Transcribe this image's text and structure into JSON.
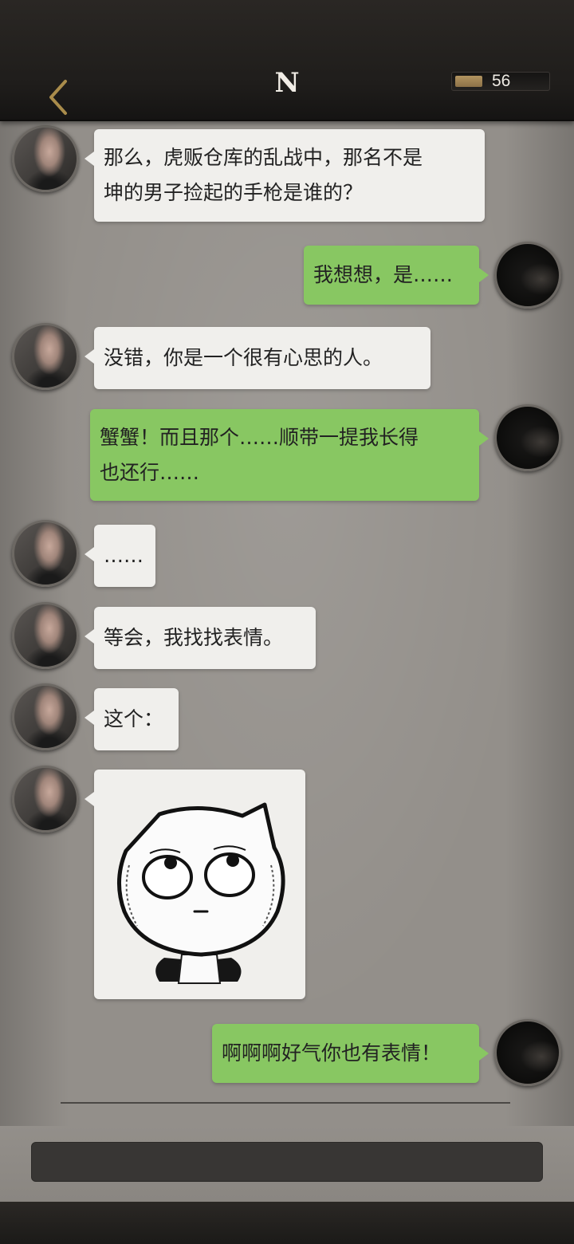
{
  "header": {
    "title": "N",
    "back_icon": "chevron-left-icon",
    "currency_icon": "gold-bar-icon",
    "currency_value": "56"
  },
  "colors": {
    "incoming_bubble": "#f0efec",
    "outgoing_bubble": "#88c762",
    "header_bg": "#1f1d1b",
    "chat_bg": "#938f8a",
    "back_icon": "#a98c4b"
  },
  "messages": [
    {
      "sender": "contact",
      "lines": [
        "那么，虎贩仓库的乱战中，那名不是",
        "坤的男子捡起的手枪是谁的？"
      ]
    },
    {
      "sender": "me",
      "lines": [
        "我想想，是……"
      ]
    },
    {
      "sender": "contact",
      "lines": [
        "没错，你是一个很有心思的人。"
      ]
    },
    {
      "sender": "me",
      "lines": [
        "蟹蟹！而且那个……顺带一提我长得",
        "也还行……"
      ]
    },
    {
      "sender": "contact",
      "lines": [
        "……"
      ]
    },
    {
      "sender": "contact",
      "lines": [
        "等会，我找找表情。"
      ]
    },
    {
      "sender": "contact",
      "lines": [
        "这个："
      ]
    },
    {
      "sender": "contact",
      "sticker": "rolling-eyes-cat-sticker"
    },
    {
      "sender": "me",
      "lines": [
        "啊啊啊好气你也有表情！"
      ]
    }
  ],
  "input": {
    "value": "",
    "placeholder": ""
  }
}
